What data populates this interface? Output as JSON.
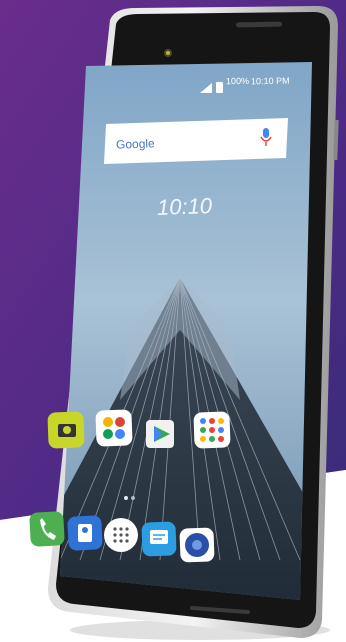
{
  "status_bar": {
    "battery_text": "100%",
    "time_text": "10:10 PM"
  },
  "search_widget": {
    "logo": "Google",
    "mic_icon": "mic-icon"
  },
  "clock": {
    "time": "10:10"
  },
  "dock": {
    "icons": [
      "phone-icon",
      "contacts-icon",
      "app-drawer-icon",
      "messages-icon",
      "music-icon"
    ]
  },
  "home_row": {
    "icons": [
      "camera-icon",
      "gallery-icon",
      "play-store-icon",
      "google-apps-folder-icon"
    ]
  },
  "colors": {
    "background_purple": "#5a2a8a",
    "phone_body": "#1a1a1a",
    "screen_sky": "#8fb3cf",
    "google_mic": "#4285f4"
  }
}
